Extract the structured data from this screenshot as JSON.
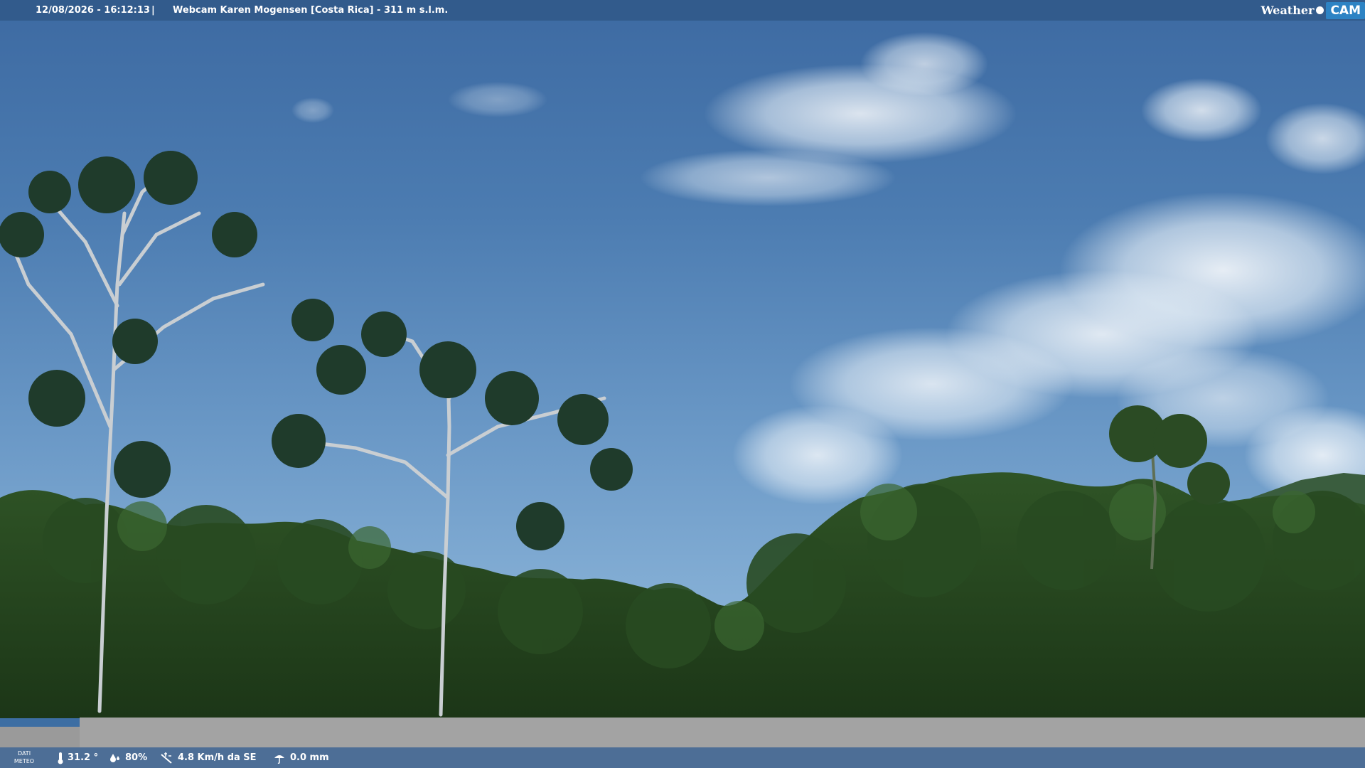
{
  "header": {
    "datetime": "12/08/2026 - 16:12:13",
    "separator": "|",
    "title": "Webcam Karen Mogensen [Costa Rica]  - 311 m s.l.m.",
    "logo_weather": "Weather",
    "logo_cam": "CAM"
  },
  "footer": {
    "dati_line1": "DATI",
    "dati_line2": "METEO",
    "temperature": "31.2 °",
    "humidity": "80%",
    "wind": "4.8 Km/h da SE",
    "rain": "0.0 mm"
  },
  "icons": {
    "temperature": "thermometer-icon",
    "humidity": "humidity-icon",
    "wind": "wind-icon",
    "rain": "rain-icon"
  },
  "colors": {
    "top_bar": "#325b8c",
    "bottom_bar": "#4d6e96",
    "cam_badge": "#2d83c4",
    "grey_band": "#a3a3a3"
  }
}
